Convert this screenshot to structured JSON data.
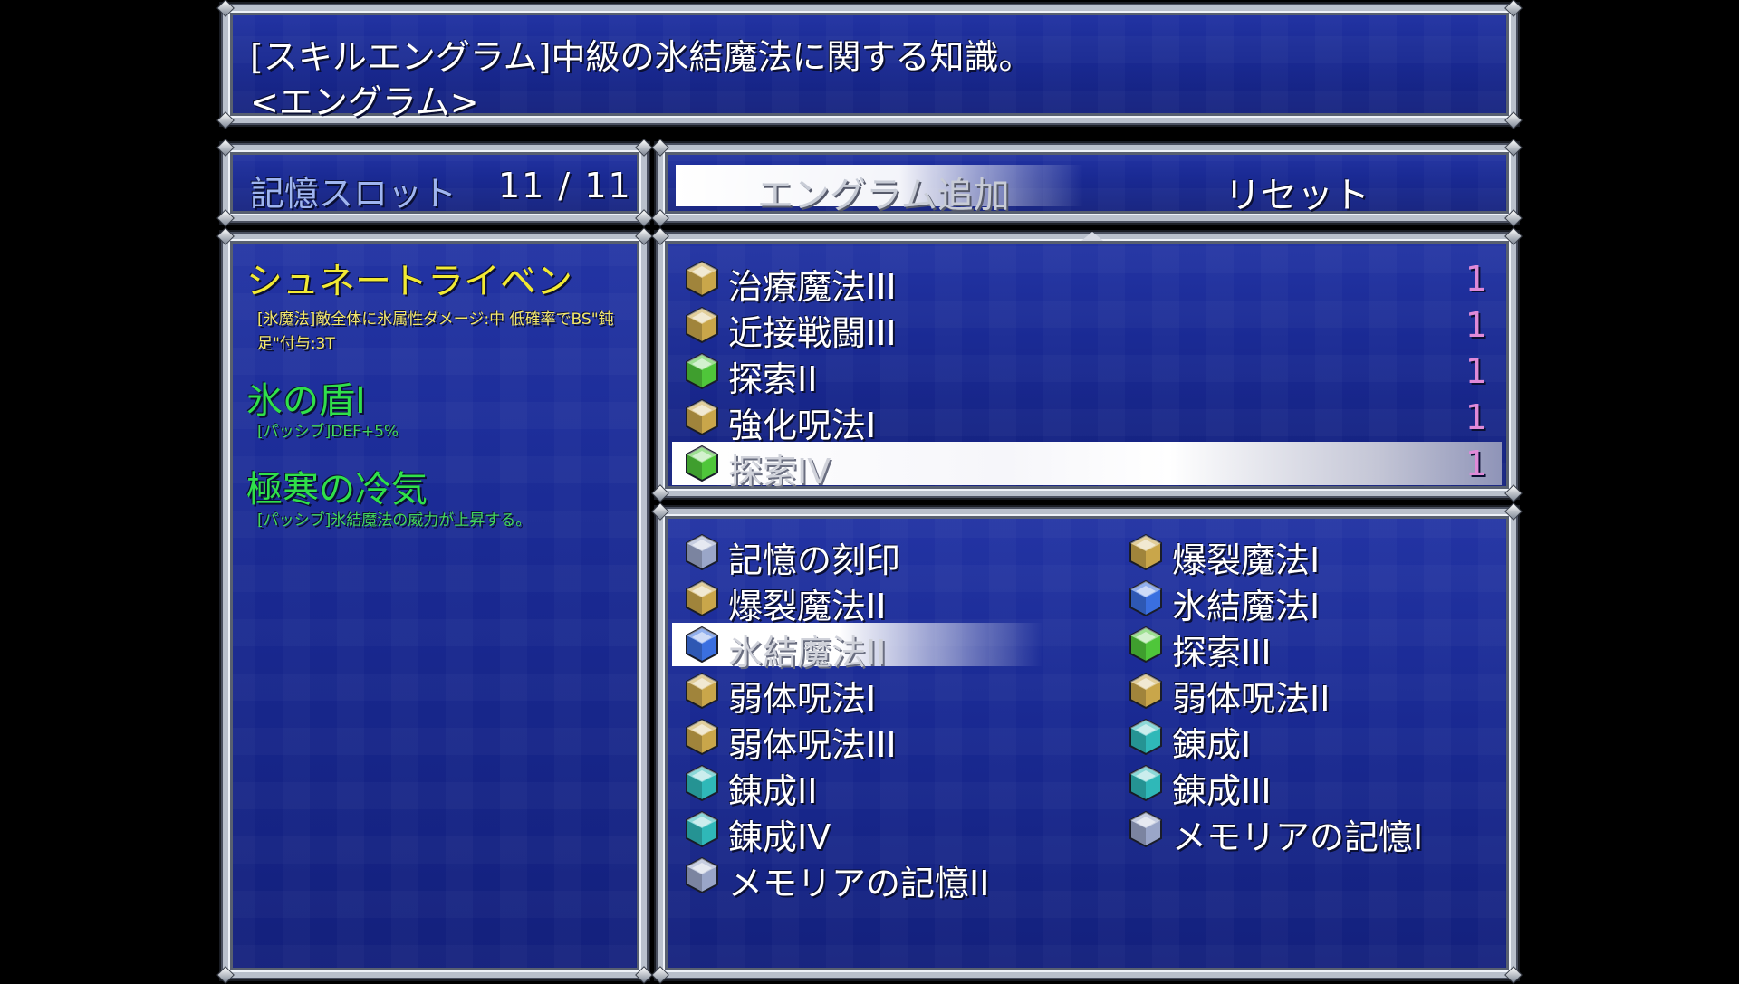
{
  "message": {
    "line1": "[スキルエングラム]中級の氷結魔法に関する知識。",
    "line2": "<エングラム>"
  },
  "memory_slot": {
    "label": "記憶スロット",
    "count": "11 / 11"
  },
  "commands": {
    "add_label": "エングラム追加",
    "reset_label": "リセット",
    "selected": "add"
  },
  "skill_info": {
    "entries": [
      {
        "name": "シュネートライベン",
        "desc": "[氷魔法]敵全体に氷属性ダメージ:中 低確率でBS\"鈍足\"付与:3T",
        "color": "#f2ea34"
      },
      {
        "name": "氷の盾I",
        "desc": "[パッシブ]DEF+5%",
        "color": "#30e04a"
      },
      {
        "name": "極寒の冷気",
        "desc": "[パッシブ]氷結魔法の威力が上昇する。",
        "color": "#30e04a"
      }
    ]
  },
  "gem_colors": {
    "gold": "#c9a64a",
    "green": "#4fc63a",
    "blue": "#3a6fe0",
    "teal": "#2fb8b8",
    "silver": "#9aa6c8"
  },
  "equipped": {
    "items": [
      {
        "label": "治療魔法III",
        "count": "1",
        "gem": "gold"
      },
      {
        "label": "近接戦闘III",
        "count": "1",
        "gem": "gold"
      },
      {
        "label": "探索II",
        "count": "1",
        "gem": "green"
      },
      {
        "label": "強化呪法I",
        "count": "1",
        "gem": "gold"
      },
      {
        "label": "探索IV",
        "count": "1",
        "gem": "green",
        "selected": true
      }
    ]
  },
  "available": {
    "items": [
      {
        "label": "記憶の刻印",
        "gem": "silver"
      },
      {
        "label": "爆裂魔法I",
        "gem": "gold"
      },
      {
        "label": "爆裂魔法II",
        "gem": "gold"
      },
      {
        "label": "氷結魔法I",
        "gem": "blue"
      },
      {
        "label": "氷結魔法II",
        "gem": "blue",
        "selected": true
      },
      {
        "label": "探索III",
        "gem": "green"
      },
      {
        "label": "弱体呪法I",
        "gem": "gold"
      },
      {
        "label": "弱体呪法II",
        "gem": "gold"
      },
      {
        "label": "弱体呪法III",
        "gem": "gold"
      },
      {
        "label": "錬成I",
        "gem": "teal"
      },
      {
        "label": "錬成II",
        "gem": "teal"
      },
      {
        "label": "錬成III",
        "gem": "teal"
      },
      {
        "label": "錬成IV",
        "gem": "teal"
      },
      {
        "label": "メモリアの記憶I",
        "gem": "silver"
      },
      {
        "label": "メモリアの記憶II",
        "gem": "silver"
      }
    ]
  }
}
